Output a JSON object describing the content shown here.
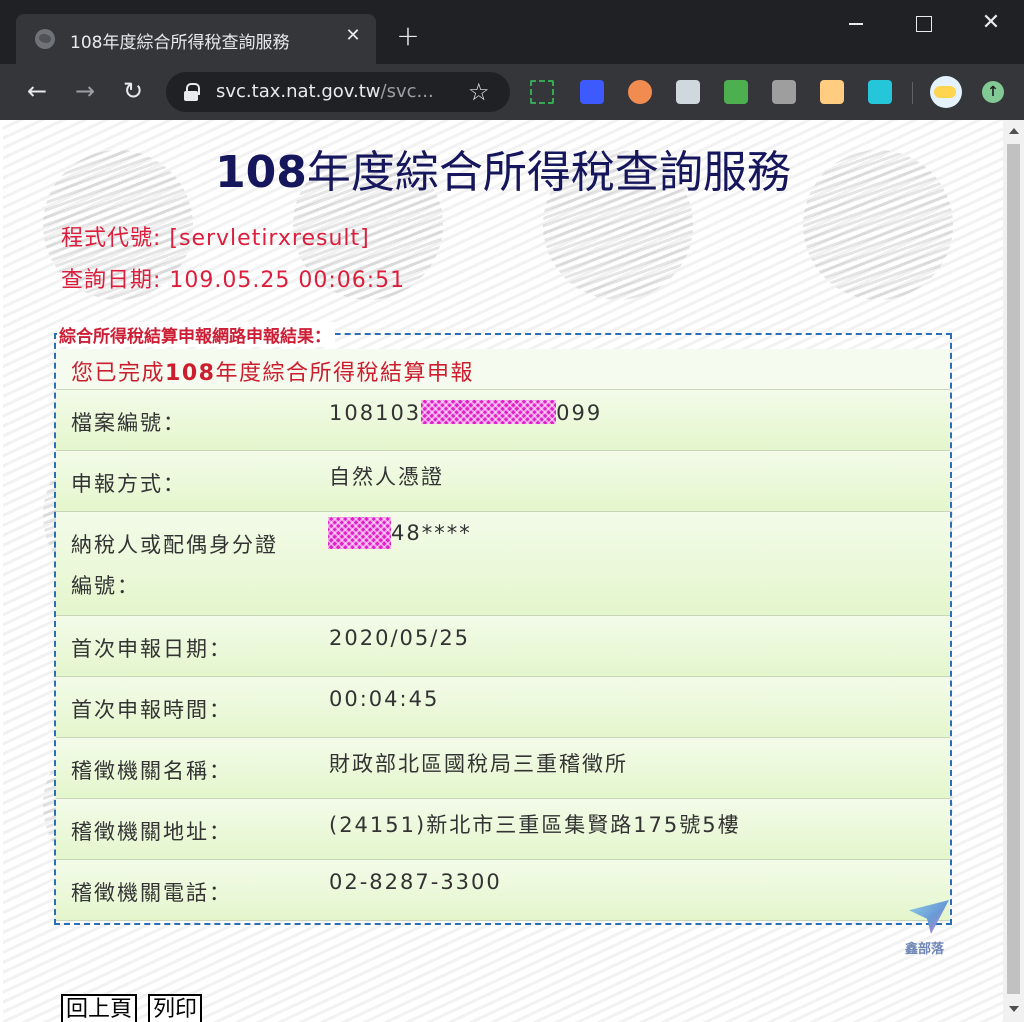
{
  "browser": {
    "tab_title": "108年度綜合所得稅查詢服務",
    "tab_close": "✕",
    "new_tab": "+",
    "url_domain": "svc.tax.nat.gov.tw",
    "url_rest": "/svc...",
    "star": "☆",
    "back": "←",
    "forward": "→",
    "reload": "↻",
    "close_window": "✕",
    "update": "↑"
  },
  "page": {
    "title_number": "108",
    "title_text": "年度綜合所得稅查詢服務",
    "program_code": "程式代號: [servletirxresult]",
    "query_date": "查詢日期: 109.05.25 00:06:51",
    "legend": "綜合所得稅結算申報網路申報結果：",
    "completion_prefix": "您已完成",
    "completion_year": "108",
    "completion_suffix": "年度綜合所得稅結算申報",
    "rows": [
      {
        "label": "檔案編號：",
        "value_prefix": "108103",
        "value_suffix": "099"
      },
      {
        "label": "申報方式：",
        "value": "自然人憑證"
      },
      {
        "label_line1": "納稅人或配偶身分證",
        "label_line2": "編號：",
        "value_suffix": "48****"
      },
      {
        "label": "首次申報日期：",
        "value": "2020/05/25"
      },
      {
        "label": "首次申報時間：",
        "value": "00:04:45"
      },
      {
        "label": "稽徵機關名稱：",
        "value": "財政部北區國稅局三重稽徵所"
      },
      {
        "label": "稽徵機關地址：",
        "value": "(24151)新北市三重區集賢路175號5樓"
      },
      {
        "label": "稽徵機關電話：",
        "value": "02-8287-3300"
      }
    ],
    "logo_text": "鑫部落",
    "back_button": "回上頁",
    "print_button": "列印"
  },
  "colors": {
    "title": "#16165c",
    "meta_red": "#dc1e3c",
    "legend_red": "#cc1e34",
    "fieldset_border": "#2a6fb5",
    "row_bg_top": "#f3fbe9",
    "row_bg_bottom": "#e4f6cc",
    "redaction": "#e020c8"
  }
}
